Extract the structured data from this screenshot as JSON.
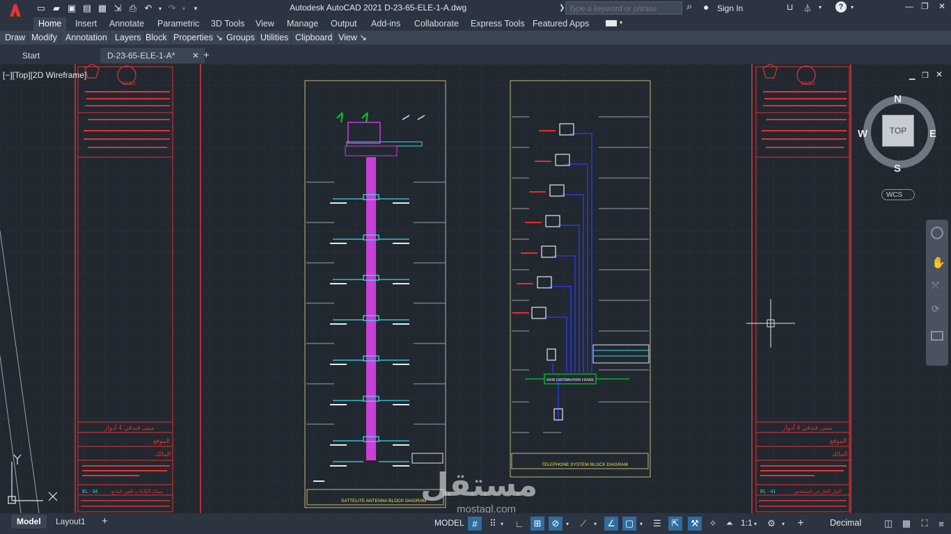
{
  "window": {
    "title": "Autodesk AutoCAD 2021    D-23-65-ELE-1-A.dwg",
    "search_placeholder": "Type a keyword or phrase",
    "sign_in": "Sign In"
  },
  "menu_tabs": [
    {
      "label": "Home",
      "active": true
    },
    {
      "label": "Insert"
    },
    {
      "label": "Annotate"
    },
    {
      "label": "Parametric"
    },
    {
      "label": "3D Tools"
    },
    {
      "label": "View"
    },
    {
      "label": "Manage"
    },
    {
      "label": "Output"
    },
    {
      "label": "Add-ins"
    },
    {
      "label": "Collaborate"
    },
    {
      "label": "Express Tools"
    },
    {
      "label": "Featured Apps"
    }
  ],
  "ribbon_panels": [
    "Draw",
    "Modify",
    "Annotation",
    "Layers",
    "Block",
    "Properties ↘",
    "Groups",
    "Utilities",
    "Clipboard",
    "View ↘"
  ],
  "doc_tabs": {
    "start": "Start",
    "active": "D-23-65-ELE-1-A*",
    "close": "✕",
    "add": "+"
  },
  "viewport": {
    "label": "[−][Top][2D Wireframe]",
    "viewcube": {
      "top": "TOP",
      "north": "N",
      "south": "S",
      "east": "E",
      "west": "W"
    },
    "wcs": "WCS",
    "ucs_y": "Y"
  },
  "drawing": {
    "satellite_title": "SATTELITE ANTENNA BLOCK  DIAGRAM",
    "telephone_title": "TELEPHONE SYSTEM BLOCK DIAGRAM",
    "main_distribution": "MAIN DISTRIBUTION FRAME",
    "left_sheet_no": "EL - 34",
    "right_sheet_no": "EL - 41",
    "left_sheet_title": "سباك الكابلات الفير المانع",
    "right_sheet_title": "التيار الخارجي المنخفض",
    "project": "مبنى فندقي 4 أدوار",
    "location": "الموقع",
    "owner": "المالك",
    "saso": "SASO"
  },
  "status": {
    "model_tab": "Model",
    "layout_tab": "Layout1",
    "add": "+",
    "model_space": "MODEL",
    "scale": "1:1",
    "units": "Decimal"
  },
  "watermark": {
    "arabic": "مستقل",
    "url": "mostaql.com"
  },
  "colors": {
    "bg": "#212830",
    "chrome": "#2b3440",
    "ribbon": "#3b4553",
    "accent_red": "#e63232",
    "frame_yellow": "#c8b878",
    "riser_magenta": "#c93fd8",
    "wire_blue": "#2b3ad9",
    "green": "#00d11e",
    "cyan": "#3fd6e6"
  }
}
